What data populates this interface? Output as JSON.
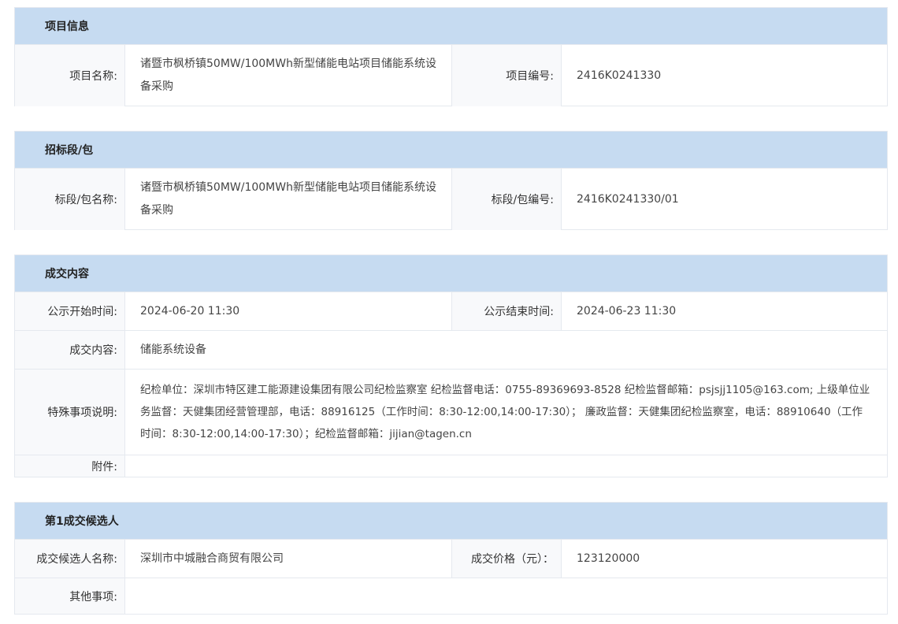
{
  "project_info": {
    "header": "项目信息",
    "name_label": "项目名称:",
    "name_value": "诸暨市枫桥镇50MW/100MWh新型储能电站项目储能系统设备采购",
    "code_label": "项目编号:",
    "code_value": "2416K0241330"
  },
  "bid_section": {
    "header": "招标段/包",
    "name_label": "标段/包名称:",
    "name_value": "诸暨市枫桥镇50MW/100MWh新型储能电站项目储能系统设备采购",
    "code_label": "标段/包编号:",
    "code_value": "2416K0241330/01"
  },
  "deal_content": {
    "header": "成交内容",
    "start_label": "公示开始时间:",
    "start_value": "2024-06-20 11:30",
    "end_label": "公示结束时间:",
    "end_value": "2024-06-23 11:30",
    "content_label": "成交内容:",
    "content_value": "储能系统设备",
    "special_label": "特殊事项说明:",
    "special_value": "纪检单位：深圳市特区建工能源建设集团有限公司纪检监察室 纪检监督电话：0755-89369693-8528 纪检监督邮箱：psjsjj1105@163.com; 上级单位业务监督：天健集团经营管理部，电话：88916125（工作时间：8:30-12:00,14:00-17:30）； 廉政监督：天健集团纪检监察室，电话：88910640（工作时间：8:30-12:00,14:00-17:30）；纪检监督邮箱：jijian@tagen.cn",
    "attachment_label": "附件:",
    "attachment_value": ""
  },
  "candidate": {
    "header": "第1成交候选人",
    "name_label": "成交候选人名称:",
    "name_value": "深圳市中城融合商贸有限公司",
    "price_label": "成交价格（元）：",
    "price_value": "123120000",
    "other_label": "其他事项:",
    "other_value": ""
  }
}
